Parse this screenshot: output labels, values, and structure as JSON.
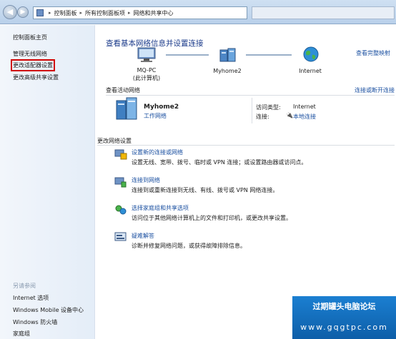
{
  "addressbar": {
    "segments": [
      "控制面板",
      "所有控制面板项",
      "网络和共享中心"
    ]
  },
  "sidebar": {
    "items": [
      {
        "label": "控制面板主页"
      },
      {
        "label": "管理无线网络"
      },
      {
        "label": "更改适配器设置"
      },
      {
        "label": "更改高级共享设置"
      }
    ],
    "see_also_heading": "另请参阅",
    "see_also": [
      {
        "label": "Internet 选项"
      },
      {
        "label": "Windows Mobile 设备中心"
      },
      {
        "label": "Windows 防火墙"
      },
      {
        "label": "家庭组"
      }
    ]
  },
  "main": {
    "heading": "查看基本网络信息并设置连接",
    "full_map_link": "查看完整映射",
    "map": {
      "computer_label_1": "MQ-PC",
      "computer_label_2": "(此计算机)",
      "network_label": "Myhome2",
      "internet_label": "Internet"
    },
    "active": {
      "title": "查看活动网络",
      "connect_link": "连接或断开连接",
      "network_name": "Myhome2",
      "network_type": "工作网络",
      "access_type_label": "访问类型:",
      "access_type_value": "Internet",
      "connection_label": "连接:",
      "connection_value": "本地连接"
    },
    "change": {
      "title": "更改网络设置",
      "tasks": [
        {
          "title": "设置新的连接或网络",
          "desc": "设置无线、宽带、拨号、临时或 VPN 连接；或设置路由器或访问点。"
        },
        {
          "title": "连接到网络",
          "desc": "连接到或重新连接到无线、有线、拨号或 VPN 网络连接。"
        },
        {
          "title": "选择家庭组和共享选项",
          "desc": "访问位于其他网络计算机上的文件和打印机，或更改共享设置。"
        },
        {
          "title": "疑难解答",
          "desc": "诊断并修复网络问题，或获得故障排除信息。"
        }
      ]
    }
  },
  "watermark": {
    "line1": "过期罐头电脑论坛",
    "line2": "www.gqgtpc.com"
  },
  "colors": {
    "link": "#1a4fa0",
    "heading": "#1a3a8a",
    "highlight_border": "#d00000",
    "watermark_bg": "#1b7fd1"
  }
}
